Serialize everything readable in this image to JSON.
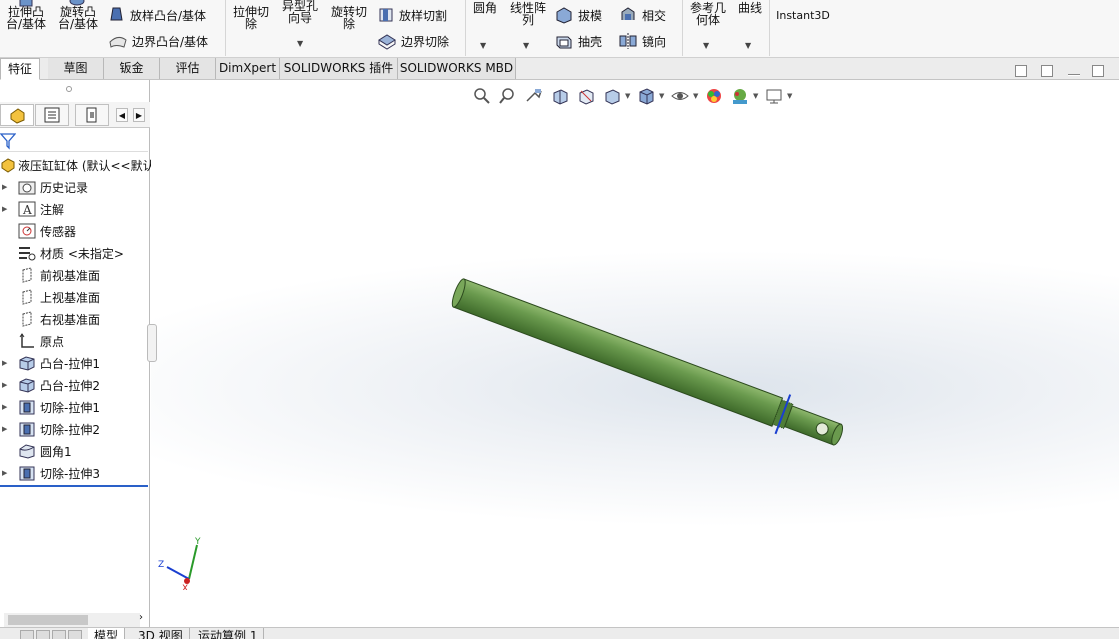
{
  "ribbon": {
    "extrude_boss": "拉伸凸\n台/基体",
    "revolve_boss": "旋转凸\n台/基体",
    "loft_boss": "放样凸台/基体",
    "boundary_boss": "边界凸台/基体",
    "extrude_cut": "拉伸切\n除",
    "hole_wizard": "异型孔\n向导",
    "revolve_cut": "旋转切\n除",
    "loft_cut": "放样切割",
    "boundary_cut": "边界切除",
    "fillet": "圆角",
    "linear_pattern": "线性阵\n列",
    "draft": "拔模",
    "shell": "抽壳",
    "intersect": "相交",
    "mirror": "镜向",
    "reference_geometry": "参考几\n何体",
    "curves": "曲线",
    "instant3d": "Instant3D"
  },
  "tabs": [
    "特征",
    "草图",
    "钣金",
    "评估",
    "DimXpert",
    "SOLIDWORKS 插件",
    "SOLIDWORKS MBD"
  ],
  "feature_tree": {
    "root": "液压缸缸体 (默认<<默认",
    "items": [
      "历史记录",
      "注解",
      "传感器",
      "材质 <未指定>",
      "前视基准面",
      "上视基准面",
      "右视基准面",
      "原点",
      "凸台-拉伸1",
      "凸台-拉伸2",
      "切除-拉伸1",
      "切除-拉伸2",
      "圆角1",
      "切除-拉伸3"
    ]
  },
  "triad": {
    "x": "X",
    "y": "Y",
    "z": "Z"
  },
  "bottom_tabs": [
    "模型",
    "3D 视图",
    "运动算例 1"
  ],
  "colors": {
    "model": "#6a9a4e",
    "accent": "#2a60c8"
  }
}
